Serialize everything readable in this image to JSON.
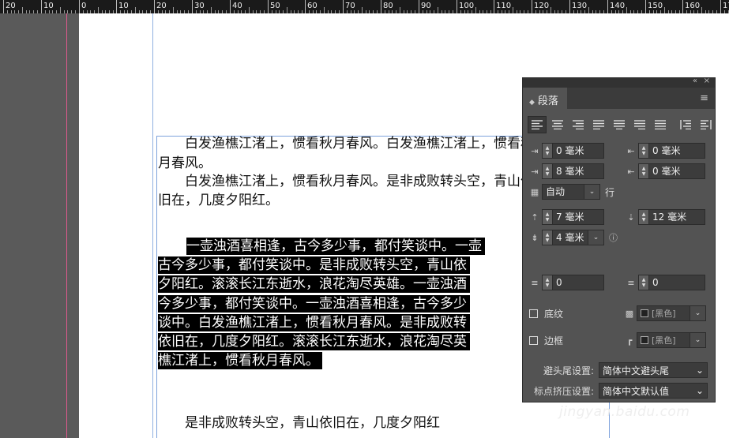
{
  "ruler": {
    "labels": [
      "20",
      "10",
      "0",
      "10",
      "20",
      "30",
      "40",
      "50",
      "60",
      "70",
      "80",
      "90",
      "100",
      "110",
      "120",
      "130",
      "140",
      "150",
      "160",
      "170"
    ]
  },
  "document": {
    "lines": [
      "　　白发渔樵江渚上，惯看秋月春风。白发渔樵江渚上，惯看秋",
      "月春风。",
      "　　白发渔樵江渚上，惯看秋月春风。是非成败转头空，青山依",
      "旧在，几度夕阳红。",
      "　　是非成败转头空，青山依旧在，几度夕阳红"
    ],
    "selected_lines": [
      "一壶浊酒喜相逢，古今多少事，都付笑谈中。一壶",
      "古今多少事，都付笑谈中。是非成败转头空，青山依",
      "夕阳红。滚滚长江东逝水，浪花淘尽英雄。一壶浊酒",
      "今多少事，都付笑谈中。一壶浊酒喜相逢，古今多少",
      "谈中。白发渔樵江渚上，惯看秋月春风。是非成败转",
      "依旧在，几度夕阳红。滚滚长江东逝水，浪花淘尽英",
      "樵江渚上，惯看秋月春风。"
    ]
  },
  "panel": {
    "collapse_icon": "«",
    "close_icon": "×",
    "title": "段落",
    "menu_icon": "≡",
    "left_indent": "0 毫米",
    "right_indent": "0 毫米",
    "first_line_indent": "8 毫米",
    "last_line_indent": "0 毫米",
    "grid_mode": "自动",
    "grid_unit": "行",
    "space_before": "7 毫米",
    "space_after": "12 毫米",
    "dropcap_lines": "4 毫米",
    "baseline_shift_left": "0",
    "baseline_shift_right": "0",
    "shading_label": "底纹",
    "shading_color": "[黑色]",
    "border_label": "边框",
    "border_color": "[黑色]",
    "kinsoku_label": "避头尾设置:",
    "kinsoku_value": "简体中文避头尾",
    "mojikumi_label": "标点挤压设置:",
    "mojikumi_value": "简体中文默认值"
  },
  "watermark": "jingyan.baidu.com"
}
